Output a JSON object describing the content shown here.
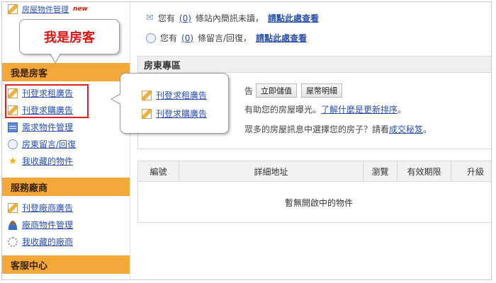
{
  "sidebar": {
    "top_item_label": "房屋物件管理",
    "top_item_badge": "new",
    "section_renter": {
      "title": "我是房客",
      "items": [
        {
          "label": "刊登求租廣告",
          "icon": "pencil-icon"
        },
        {
          "label": "刊登求購廣告",
          "icon": "pencil-icon"
        },
        {
          "label": "需求物件管理",
          "icon": "table-icon"
        },
        {
          "label": "房東留言/回復",
          "icon": "chat-bubble-icon"
        },
        {
          "label": "我收藏的物件",
          "icon": "star-icon"
        }
      ]
    },
    "section_vendor": {
      "title": "服務廠商",
      "items": [
        {
          "label": "刊登廠商廣告",
          "icon": "pencil-icon"
        },
        {
          "label": "廠商物件管理",
          "icon": "user-icon"
        },
        {
          "label": "我收藏的廠商",
          "icon": "gear-icon"
        }
      ]
    },
    "section_service": {
      "title": "客服中心"
    }
  },
  "callouts": {
    "title": "我是房客",
    "items": [
      "刊登求租廣告",
      "刊登求購廣告"
    ]
  },
  "messages": {
    "line1_prefix": "您有",
    "line1_count": "(0)",
    "line1_suffix": "條站內簡訊未讀，",
    "line1_link": "請點此處查看",
    "line2_prefix": "您有",
    "line2_count": "(0)",
    "line2_suffix": "條留言/回復，",
    "line2_link": "請點此處查看"
  },
  "landlord": {
    "title": "房東專區",
    "btn_fragment": "告",
    "buttons": [
      "立即儲值",
      "屋幣明細"
    ],
    "line1_text": "有助您的房屋曝光。",
    "line1_link": "了解什麼是更新排序",
    "line1_end": "。",
    "line2_text": "眾多的房屋訊息中選擇您的房子？請看",
    "line2_link": "成交秘笈",
    "line2_end": "。"
  },
  "table": {
    "columns": [
      "編號",
      "詳細地址",
      "瀏覽",
      "有效期限",
      "升級"
    ],
    "empty_text": "暫無開啟中的物件"
  },
  "colors": {
    "section_header": "#f4a83a",
    "link": "#2a4fa8",
    "highlight_border": "#dd2222",
    "callout_text": "#d81414"
  }
}
